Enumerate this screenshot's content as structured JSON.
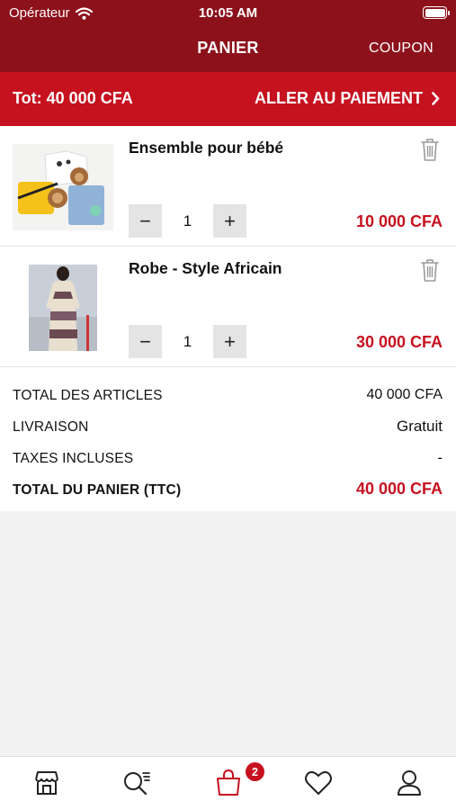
{
  "status_bar": {
    "carrier": "Opérateur",
    "time": "10:05 AM"
  },
  "header": {
    "title": "PANIER",
    "coupon_label": "COUPON"
  },
  "total_bar": {
    "total_label": "Tot: 40 000 CFA",
    "checkout_label": "ALLER AU PAIEMENT"
  },
  "items": [
    {
      "name": "Ensemble pour bébé",
      "quantity": "1",
      "price": "10 000 CFA",
      "decrement": "−",
      "increment": "+"
    },
    {
      "name": "Robe - Style Africain",
      "quantity": "1",
      "price": "30 000 CFA",
      "decrement": "−",
      "increment": "+"
    }
  ],
  "summary": {
    "articles_label": "TOTAL DES ARTICLES",
    "articles_value": "40 000 CFA",
    "delivery_label": "LIVRAISON",
    "delivery_value": "Gratuit",
    "taxes_label": "TAXES INCLUSES",
    "taxes_value": "-",
    "cart_total_label": "TOTAL DU PANIER (TTC)",
    "cart_total_value": "40 000 CFA"
  },
  "tabbar": {
    "tabs": [
      "store-icon",
      "search-list-icon",
      "shopping-bag-icon",
      "heart-icon",
      "user-icon"
    ],
    "cart_badge": "2"
  },
  "colors": {
    "header": "#8d111b",
    "accent": "#c6111f",
    "tab_inactive": "#222222"
  }
}
